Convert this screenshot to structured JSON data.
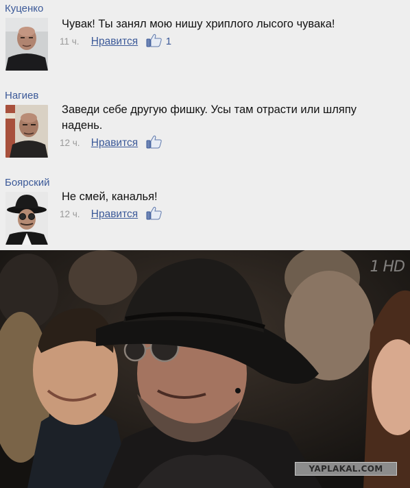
{
  "comments": [
    {
      "author": "Куценко",
      "text": "Чувак! Ты занял мою нишу хриплого лысого чувака!",
      "time": "11 ч.",
      "like_label": "Нравится",
      "like_count": "1",
      "avatar_icon": "bald-man-avatar"
    },
    {
      "author": "Нагиев",
      "text": "Заведи себе другую фишку. Усы там отрасти или шляпу надень.",
      "time": "12 ч.",
      "like_label": "Нравится",
      "avatar_icon": "bald-man-avatar"
    },
    {
      "author": "Боярский",
      "text": "Не смей, каналья!",
      "time": "12 ч.",
      "like_label": "Нравится",
      "avatar_icon": "man-in-hat-avatar"
    }
  ],
  "photo": {
    "channel_logo": "1 HD",
    "watermark": "YAPLAKAL.COM"
  },
  "colors": {
    "link": "#3b5998",
    "background": "#eeeeee",
    "meta": "#999999"
  }
}
